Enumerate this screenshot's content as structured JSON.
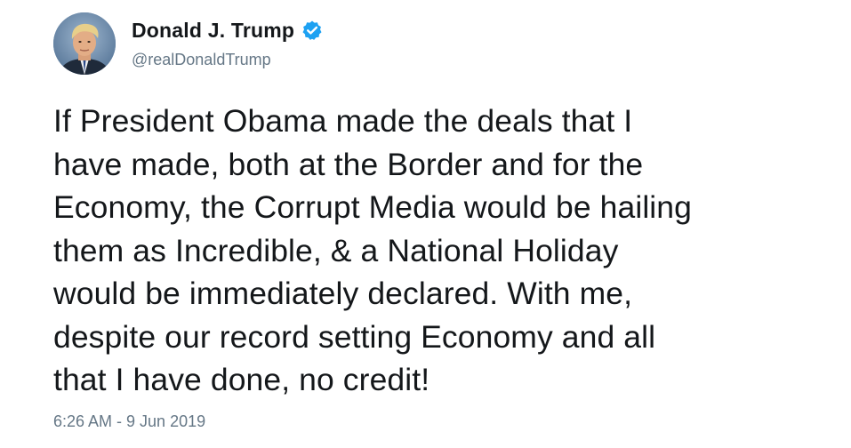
{
  "author": {
    "name": "Donald J. Trump",
    "handle": "@realDonaldTrump",
    "verified": true,
    "verified_color": "#1da1f2"
  },
  "tweet": {
    "text": "If President Obama made the deals that I\nhave made, both at the Border and for the\nEconomy, the Corrupt Media would be hailing\nthem as Incredible, & a National Holiday\nwould be immediately declared. With me,\ndespite our record setting Economy and all\nthat I have done, no credit!",
    "timestamp": "6:26 AM - 9 Jun 2019"
  },
  "icons": {
    "verified": "verified-badge-icon",
    "avatar": "profile-photo"
  },
  "colors": {
    "text": "#14171a",
    "secondary": "#657786"
  }
}
